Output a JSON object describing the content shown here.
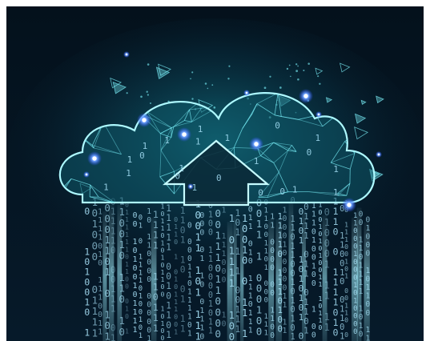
{
  "image": {
    "subject": "cloud-upload-illustration",
    "palette": {
      "background_top": "#04111c",
      "background_bottom": "#061a2a",
      "glow": "#1aa7b8",
      "wire": "#7ff6ff",
      "node": "#3a7bff",
      "digit": "#aee9ff"
    }
  }
}
